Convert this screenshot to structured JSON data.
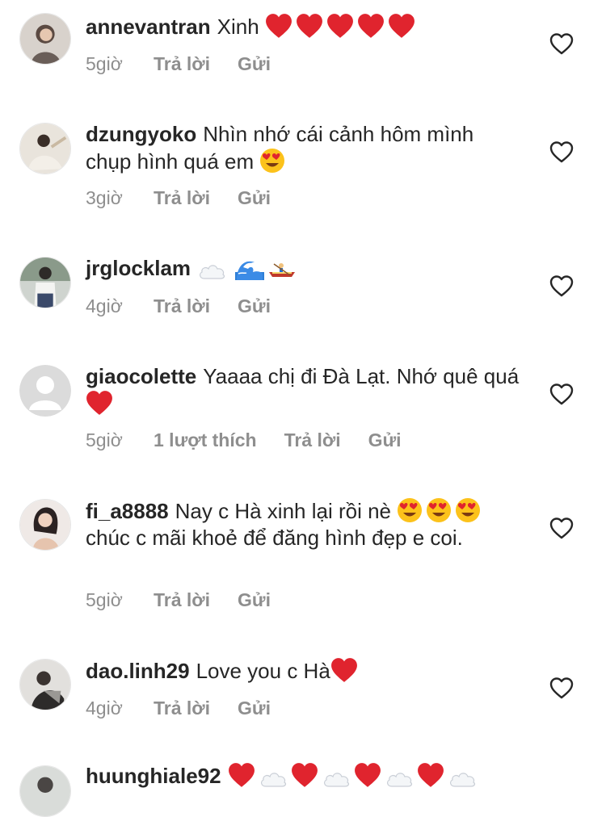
{
  "comments": [
    {
      "user": "annevantran",
      "text": "Xinh",
      "emojis_after": [
        "heart",
        "heart",
        "heart",
        "heart",
        "heart"
      ],
      "time": "5giờ",
      "likes": "",
      "reply": "Trả lời",
      "send": "Gửi"
    },
    {
      "user": "dzungyoko",
      "text": "Nhìn nhớ cái cảnh hôm mình chụp hình quá em",
      "emojis_after": [
        "heart-eyes"
      ],
      "time": "3giờ",
      "likes": "",
      "reply": "Trả lời",
      "send": "Gửi"
    },
    {
      "user": "jrglocklam",
      "text": "",
      "emojis_after": [
        "cloud",
        "wave",
        "canoe"
      ],
      "time": "4giờ",
      "likes": "",
      "reply": "Trả lời",
      "send": "Gửi"
    },
    {
      "user": "giaocolette",
      "text": "Yaaaa chị đi Đà Lạt. Nhớ quê quá",
      "emojis_after": [
        "heart"
      ],
      "time": "5giờ",
      "likes": "1 lượt thích",
      "reply": "Trả lời",
      "send": "Gửi"
    },
    {
      "user": "fi_a8888",
      "text_part1": "Nay c Hà xinh lại rồi nè",
      "text_part2": "chúc c mãi khoẻ để đăng hình đẹp e coi.",
      "time": "5giờ",
      "likes": "",
      "reply": "Trả lời",
      "send": "Gửi"
    },
    {
      "user": "dao.linh29",
      "text": "Love you c Hà",
      "emojis_after": [
        "heart"
      ],
      "time": "4giờ",
      "likes": "",
      "reply": "Trả lời",
      "send": "Gửi"
    },
    {
      "user": "huunghiale92",
      "text": "",
      "emojis_after": [
        "heart",
        "cloud",
        "heart",
        "cloud",
        "heart",
        "cloud",
        "heart",
        "cloud"
      ],
      "time": "",
      "likes": "",
      "reply": "",
      "send": ""
    }
  ],
  "icons": {
    "like": "heart-outline-icon"
  },
  "colors": {
    "heart": "#e0242e",
    "meta": "#8e8e8e",
    "text": "#262626"
  }
}
